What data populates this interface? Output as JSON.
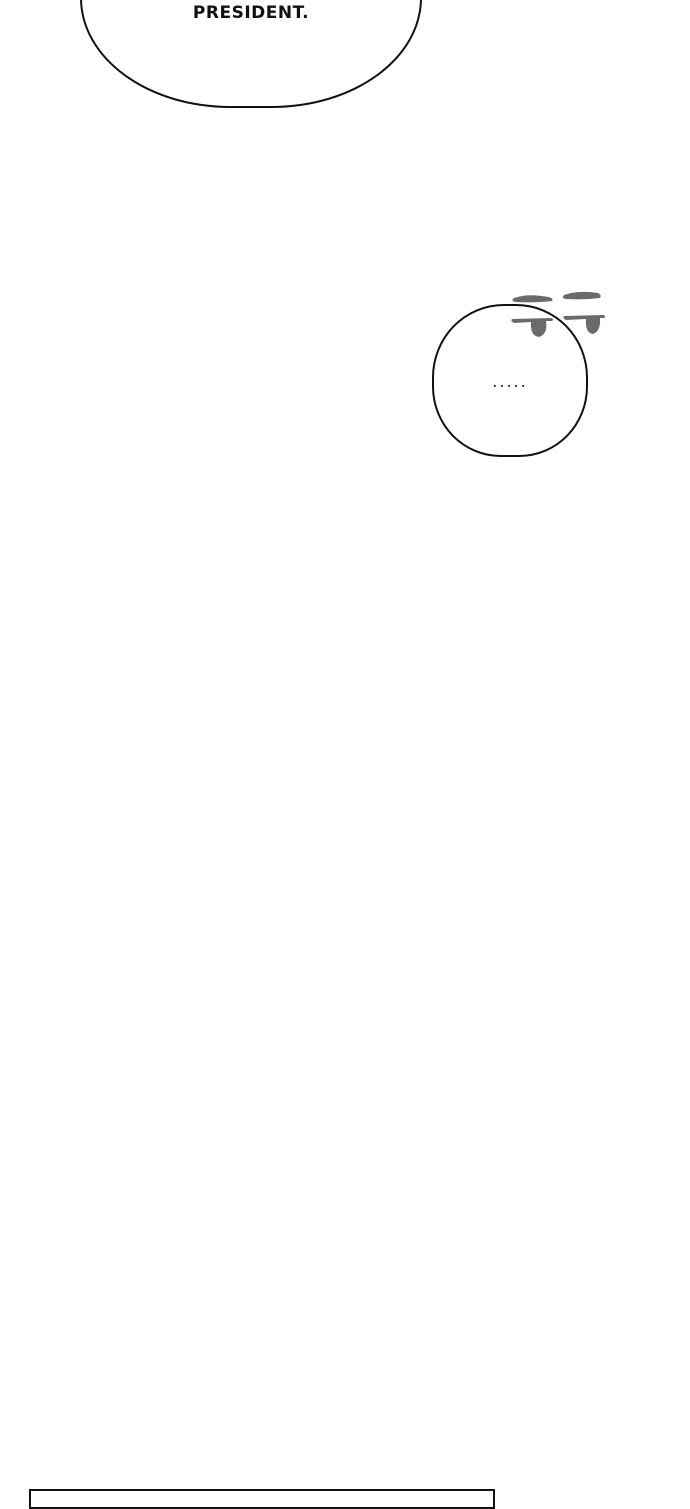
{
  "speech_bubbles": {
    "top": {
      "text": "PRESIDENT."
    },
    "small": {
      "text": "....."
    }
  },
  "colors": {
    "background": "#ffffff",
    "outline": "#111111",
    "sweat_marks": "#6b6b6b"
  }
}
